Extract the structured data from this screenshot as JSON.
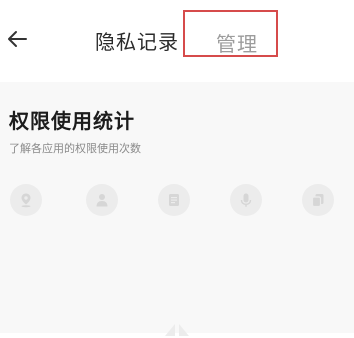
{
  "header": {
    "back_icon": "arrow-left-icon",
    "title": "隐私记录",
    "manage_label": "管理",
    "highlight_color": "#d64b4b"
  },
  "section": {
    "title": "权限使用统计",
    "subtitle": "了解各应用的权限使用次数"
  },
  "permissions": [
    {
      "icon": "location-icon"
    },
    {
      "icon": "person-icon"
    },
    {
      "icon": "document-icon"
    },
    {
      "icon": "microphone-icon"
    },
    {
      "icon": "copy-icon"
    }
  ]
}
